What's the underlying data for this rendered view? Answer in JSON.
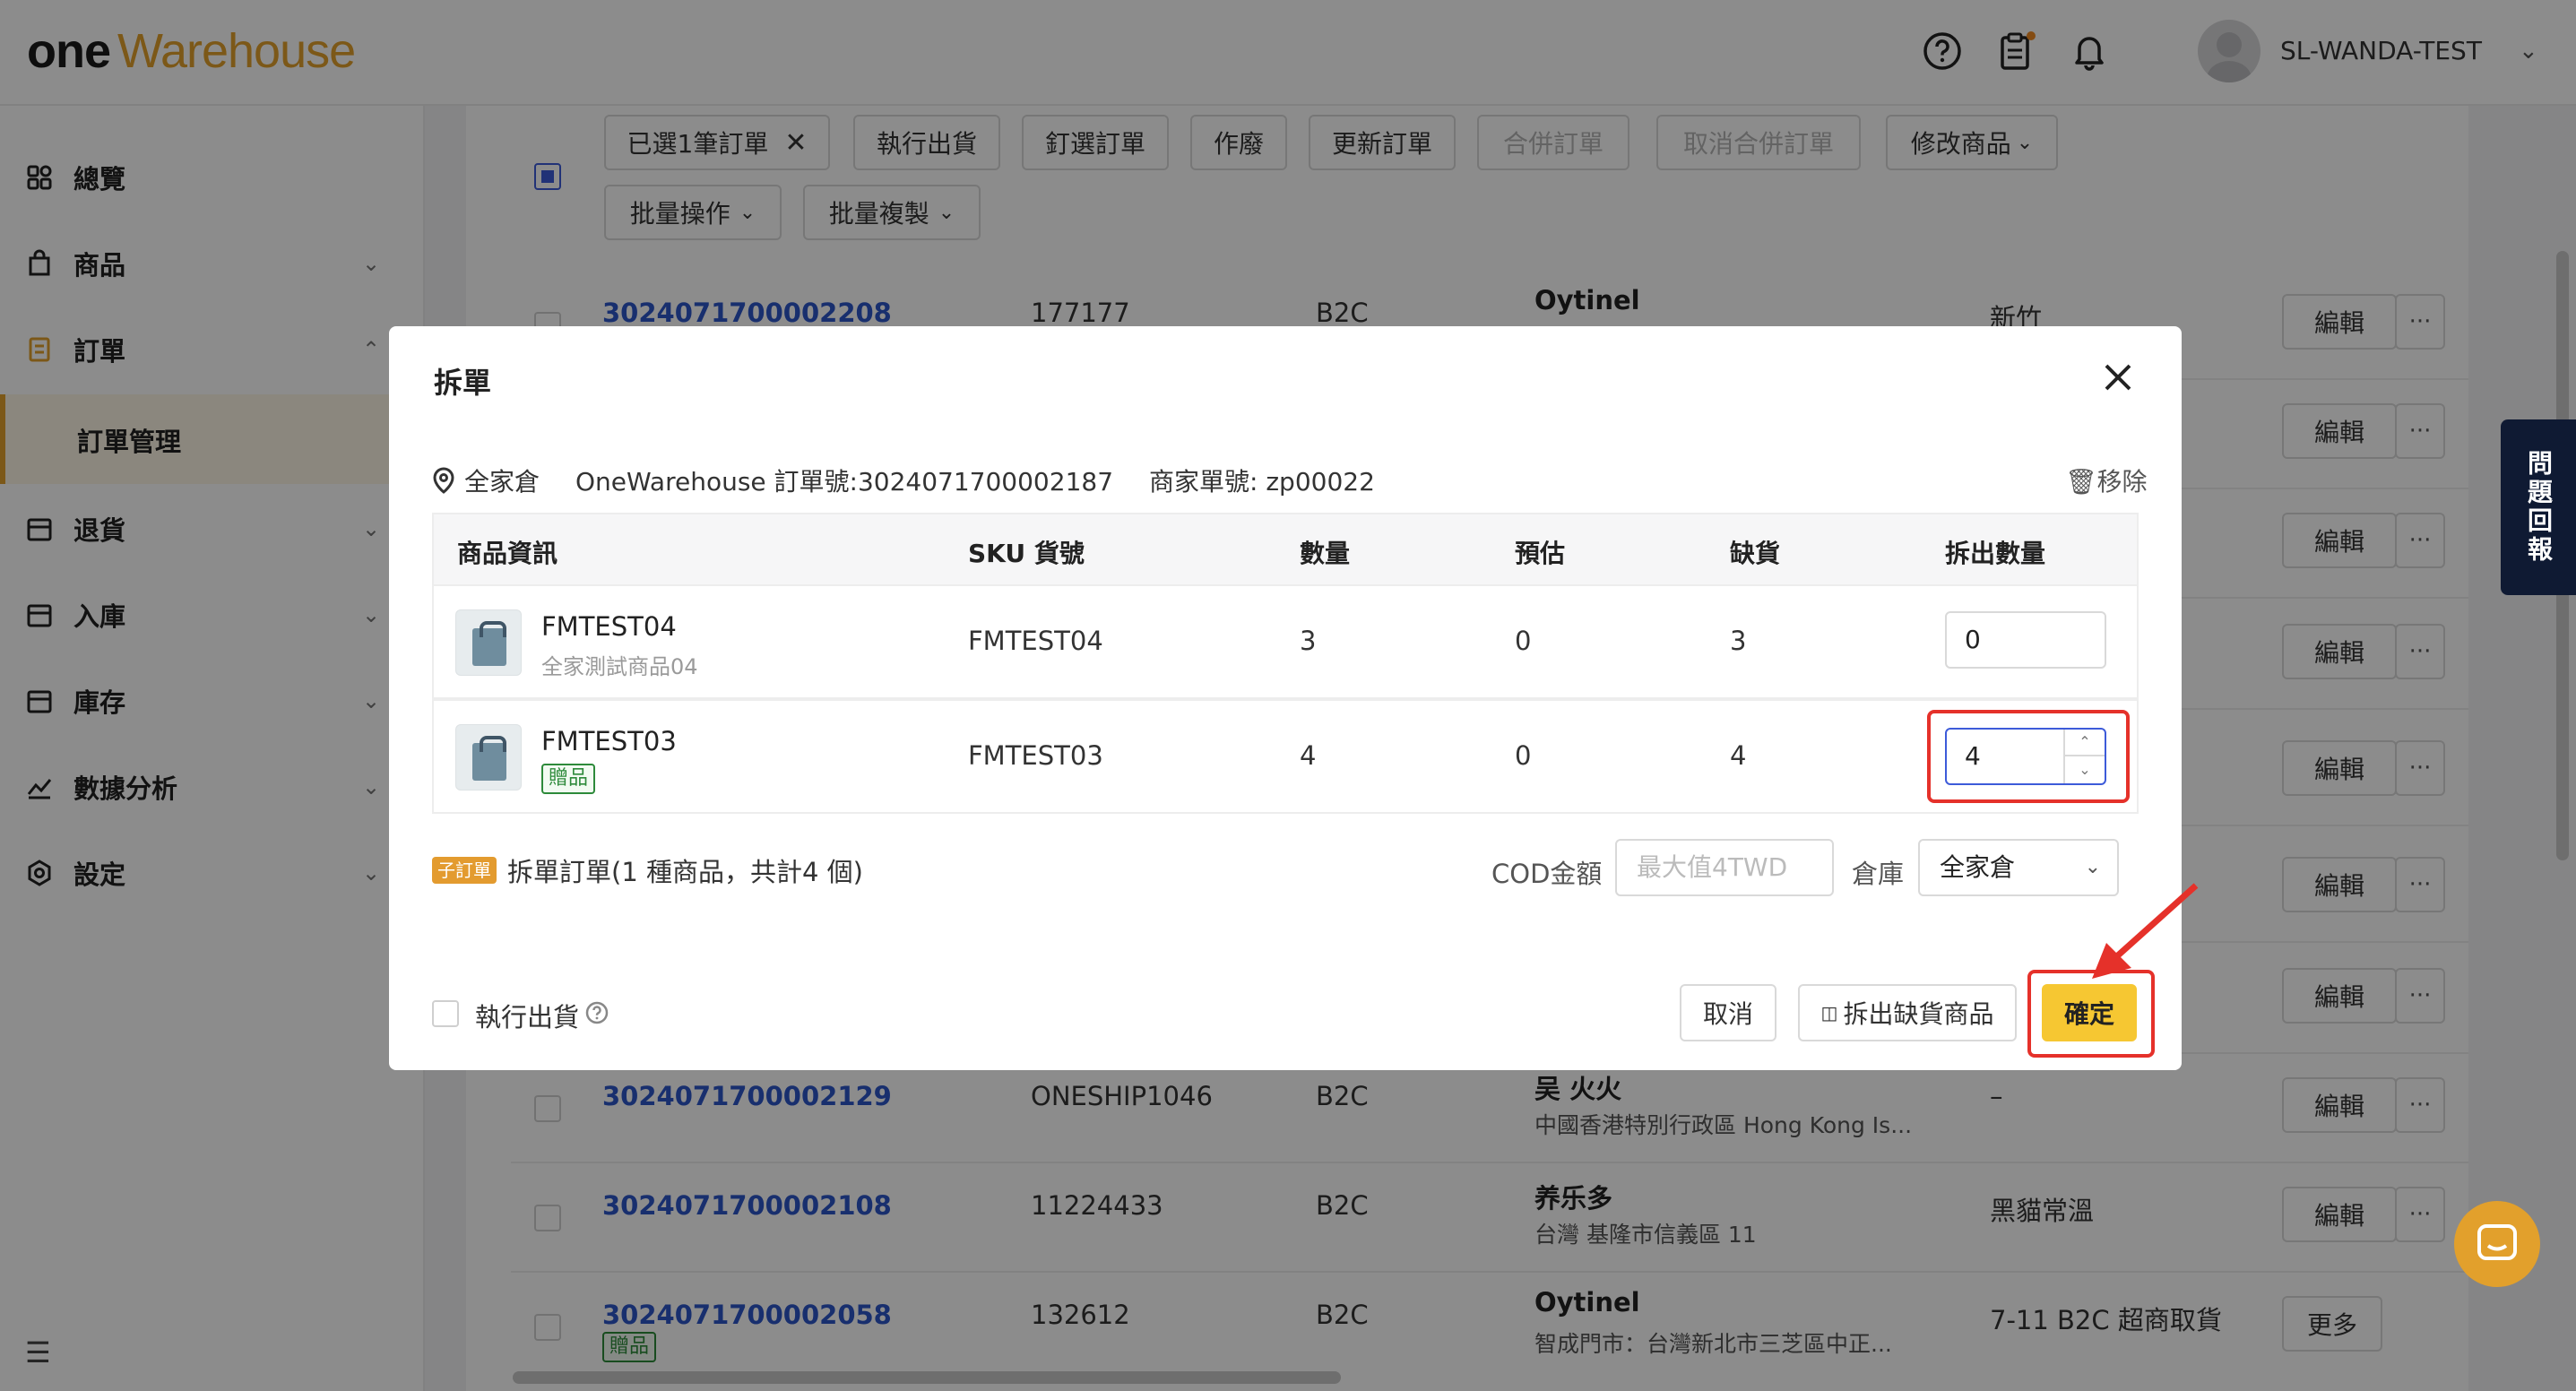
{
  "header": {
    "logo_one": "one",
    "logo_rest": "Warehouse",
    "user_name": "SL-WANDA-TEST"
  },
  "sidebar": {
    "items": [
      {
        "label": "總覽",
        "icon": "dashboard-icon"
      },
      {
        "label": "商品",
        "icon": "bag-icon"
      },
      {
        "label": "訂單",
        "icon": "order-icon"
      },
      {
        "label": "訂單管理",
        "icon": ""
      },
      {
        "label": "退貨",
        "icon": "return-icon"
      },
      {
        "label": "入庫",
        "icon": "inbound-icon"
      },
      {
        "label": "庫存",
        "icon": "stock-icon"
      },
      {
        "label": "數據分析",
        "icon": "analytics-icon"
      },
      {
        "label": "設定",
        "icon": "settings-icon"
      }
    ]
  },
  "toolbar": {
    "selected": "已選1筆訂單",
    "execute_ship": "執行出貨",
    "pin_order": "釘選訂單",
    "void": "作廢",
    "update_order": "更新訂單",
    "merge_order": "合併訂單",
    "cancel_merge": "取消合併訂單",
    "modify_product": "修改商品",
    "batch_ops": "批量操作",
    "batch_copy": "批量複製"
  },
  "orders": [
    {
      "id": "3024071700002208",
      "ref": "177177",
      "type": "B2C",
      "name": "Oytinel",
      "addr": "",
      "ship": "新竹",
      "action": "編輯"
    },
    {
      "id": "3024071700002129",
      "ref": "ONESHIP1046",
      "type": "B2C",
      "name": "吴 火火",
      "addr": "中國香港特別行政區 Hong Kong Is...",
      "ship": "–",
      "action": "編輯"
    },
    {
      "id": "3024071700002108",
      "ref": "11224433",
      "type": "B2C",
      "name": "养乐多",
      "addr": "台灣 基隆市信義區 11",
      "ship": "黑貓常溫",
      "action": "編輯"
    },
    {
      "id": "3024071700002058",
      "ref": "132612",
      "type": "B2C",
      "name": "Oytinel",
      "addr": "智成門市：台灣新北市三芝區中正...",
      "ship": "7-11 B2C 超商取貨",
      "action": "更多",
      "tag": "贈品"
    }
  ],
  "row_edit_label": "編輯",
  "feedback": {
    "label": "問題回報"
  },
  "modal": {
    "title": "拆單",
    "warehouse": "全家倉",
    "ow_order": "OneWarehouse 訂單號:3024071700002187",
    "merchant_order": "商家單號: zp00022",
    "remove": "移除",
    "columns": [
      "商品資訊",
      "SKU 貨號",
      "數量",
      "預估",
      "缺貨",
      "拆出數量"
    ],
    "rows": [
      {
        "name": "FMTEST04",
        "desc": "全家測試商品04",
        "sku": "FMTEST04",
        "qty": "3",
        "est": "0",
        "short": "3",
        "split": "0"
      },
      {
        "name": "FMTEST03",
        "tag": "贈品",
        "sku": "FMTEST03",
        "qty": "4",
        "est": "0",
        "short": "4",
        "split": "4"
      }
    ],
    "sub_tag": "子訂單",
    "sub_text": "拆單訂單(1 種商品，共計4 個)",
    "cod_label": "COD金額",
    "cod_placeholder": "最大值4TWD",
    "warehouse_label": "倉庫",
    "warehouse_value": "全家倉",
    "exec_ship": "執行出貨",
    "cancel": "取消",
    "split_short": "拆出缺貨商品",
    "confirm": "確定"
  }
}
